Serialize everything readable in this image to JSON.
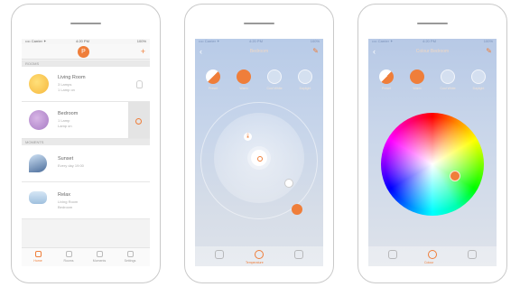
{
  "colors": {
    "accent": "#ef7e3a",
    "sky": "#b8cbe8"
  },
  "status": {
    "carrier": "•••• Carrier ✦",
    "time": "4:20 PM",
    "battery": "100%"
  },
  "home": {
    "avatar_initial": "P",
    "add_icon": "plus-icon",
    "section_rooms": "ROOMS",
    "section_moments": "MOMENTS",
    "rooms": [
      {
        "name": "Living Room",
        "line1": "3 Lamps",
        "line2": "1 Lamp on"
      },
      {
        "name": "Bedroom",
        "line1": "1 Lamp",
        "line2": "Lamp on"
      }
    ],
    "moments": [
      {
        "name": "Sunset",
        "line1": "Every day 19:00"
      },
      {
        "name": "Relax",
        "line1": "Living Room",
        "line2": "Bedroom"
      }
    ],
    "tabs": [
      "Home",
      "Rooms",
      "Moments",
      "Settings"
    ]
  },
  "room_screen": {
    "title": "Bedroom",
    "icons": [
      "Preset",
      "Warm",
      "Cool White",
      "Daylight"
    ],
    "temp_symbol": "🌡",
    "bottom_label": "Temperature"
  },
  "color_screen": {
    "title": "Colour Bedroom",
    "icons": [
      "Preset",
      "Warm",
      "Cool White",
      "Daylight"
    ],
    "bottom_label": "Colour"
  }
}
